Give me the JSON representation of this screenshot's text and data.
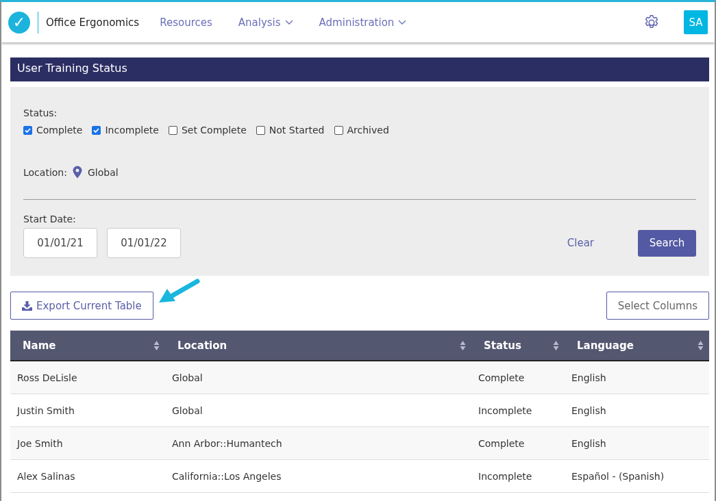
{
  "header": {
    "logo_mark": "✓",
    "app_name": "Office Ergonomics",
    "nav": [
      {
        "label": "Resources",
        "dropdown": false
      },
      {
        "label": "Analysis",
        "dropdown": true
      },
      {
        "label": "Administration",
        "dropdown": true
      }
    ],
    "avatar": "SA"
  },
  "page_title": "User Training Status",
  "filters": {
    "status_label": "Status:",
    "statuses": [
      {
        "label": "Complete",
        "checked": true
      },
      {
        "label": "Incomplete",
        "checked": true
      },
      {
        "label": "Set Complete",
        "checked": false
      },
      {
        "label": "Not Started",
        "checked": false
      },
      {
        "label": "Archived",
        "checked": false
      }
    ],
    "location_label": "Location:",
    "location": "Global",
    "start_date_label": "Start Date:",
    "dates": [
      "01/01/21",
      "01/01/22"
    ],
    "clear": "Clear",
    "search": "Search"
  },
  "export_button": "Export Current Table",
  "select_columns_button": "Select Columns",
  "table": {
    "columns": [
      "Name",
      "Location",
      "Status",
      "Language"
    ],
    "rows": [
      [
        "Ross DeLisle",
        "Global",
        "Complete",
        "English"
      ],
      [
        "Justin Smith",
        "Global",
        "Incomplete",
        "English"
      ],
      [
        "Joe Smith",
        "Ann Arbor::Humantech",
        "Complete",
        "English"
      ],
      [
        "Alex Salinas",
        "California::Los Angeles",
        "Incomplete",
        "Español - (Spanish)"
      ]
    ]
  }
}
